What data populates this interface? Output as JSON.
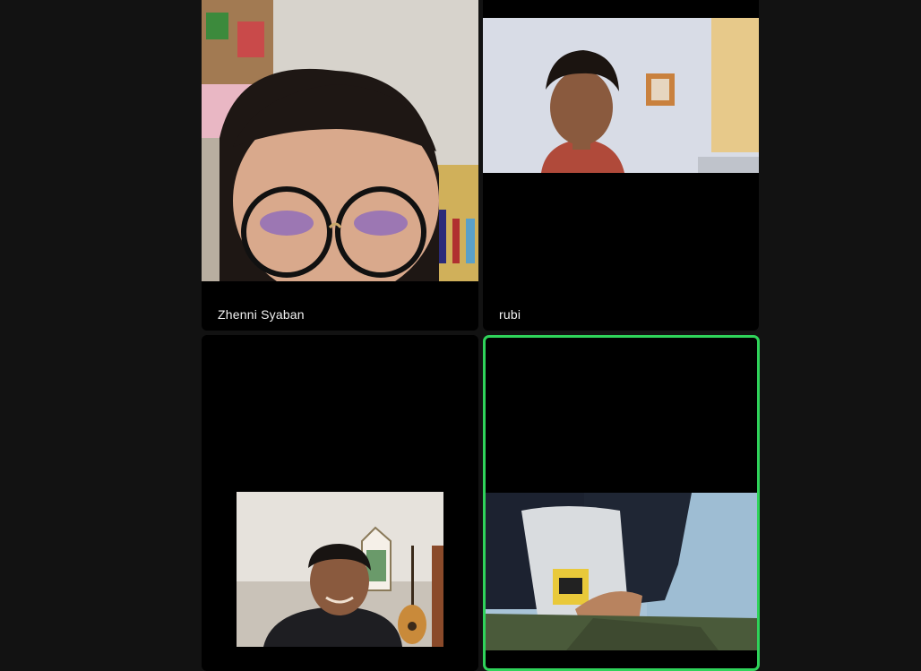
{
  "meeting": {
    "participants": [
      {
        "name": "Zhenni Syaban",
        "video": "on",
        "speaking": false
      },
      {
        "name": "rubi",
        "video": "on",
        "speaking": false
      },
      {
        "name": "",
        "video": "on",
        "speaking": false
      },
      {
        "name": "",
        "video": "on",
        "speaking": true
      }
    ],
    "colors": {
      "background": "#121212",
      "tile": "#000000",
      "active_speaker_border": "#2fd35a",
      "name_text": "#f2f2f2"
    }
  }
}
